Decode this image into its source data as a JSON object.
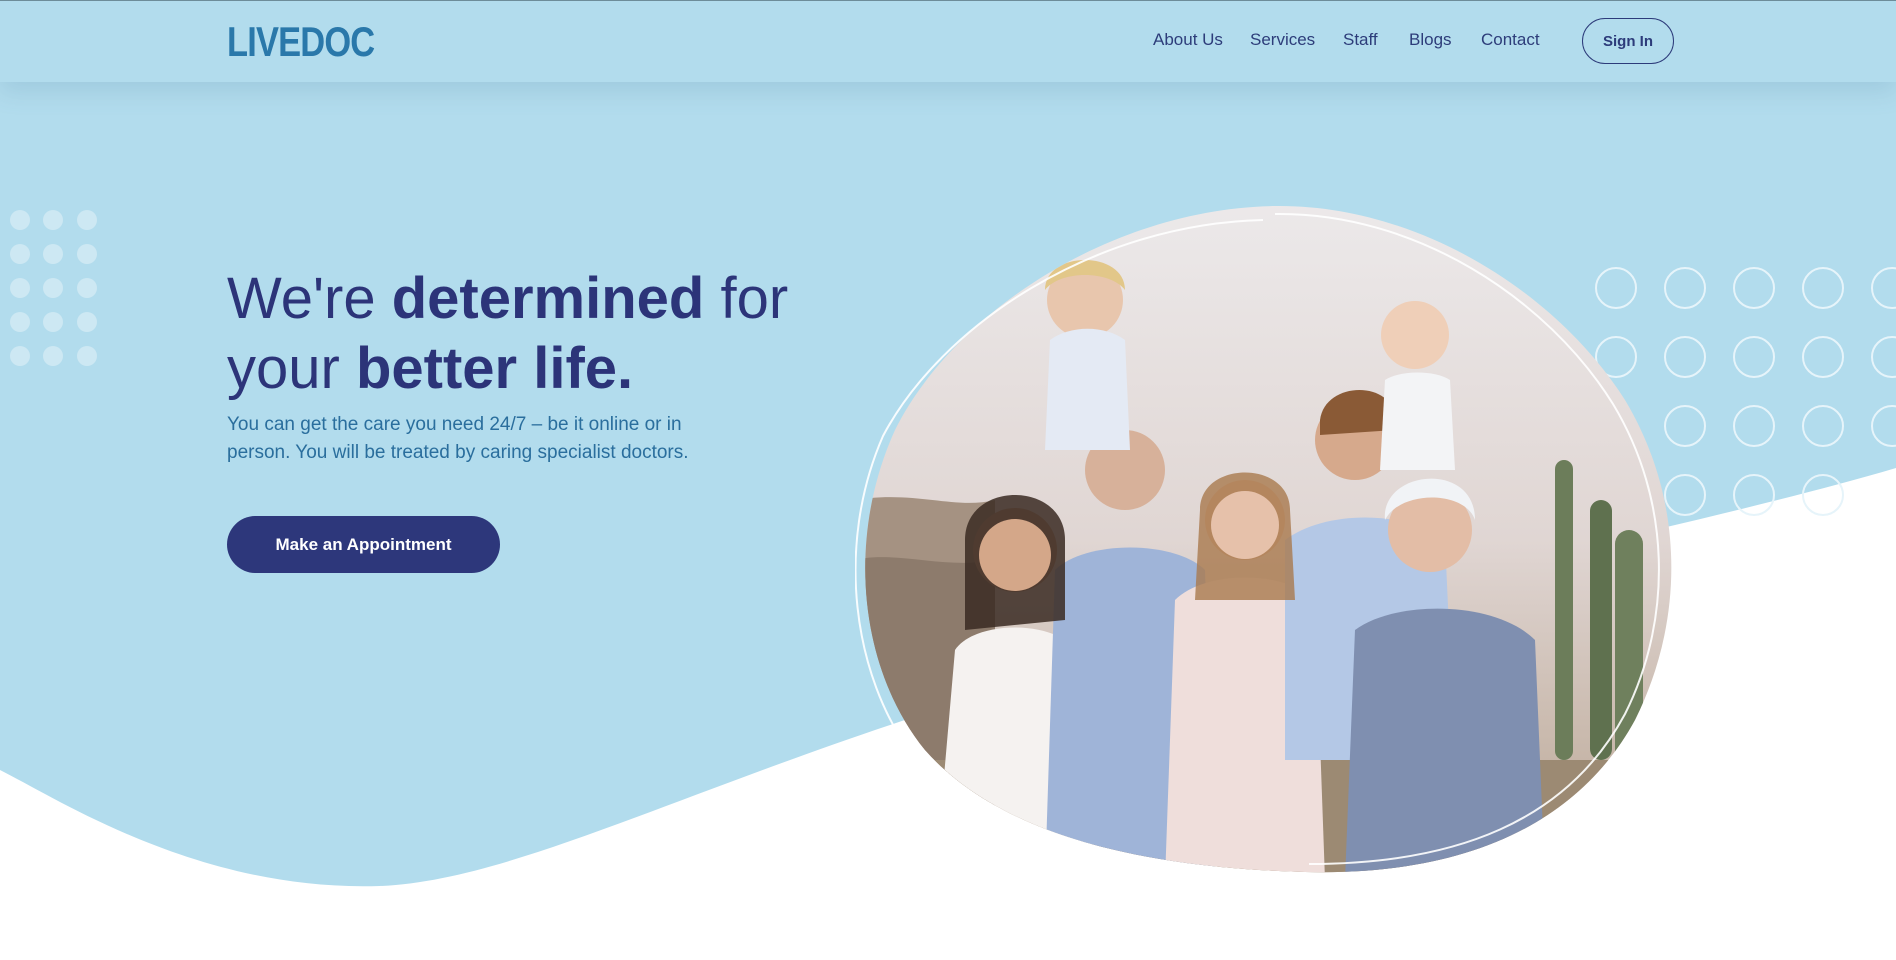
{
  "header": {
    "logo": "LIVEDOC",
    "nav": [
      "About Us",
      "Services",
      "Staff",
      "Blogs",
      "Contact"
    ],
    "sign_in": "Sign In"
  },
  "hero": {
    "headline_1": "We're ",
    "headline_bold_1": "determined",
    "headline_2": " for your ",
    "headline_bold_2": "better life.",
    "subtext": "You can get the care you need 24/7 – be it online or in person. You will be treated by caring specialist doctors.",
    "cta": "Make an Appointment",
    "image": "family-portrait"
  },
  "colors": {
    "hero_bg": "#b2dced",
    "primary": "#2d377b",
    "accent": "#2a78aa"
  }
}
